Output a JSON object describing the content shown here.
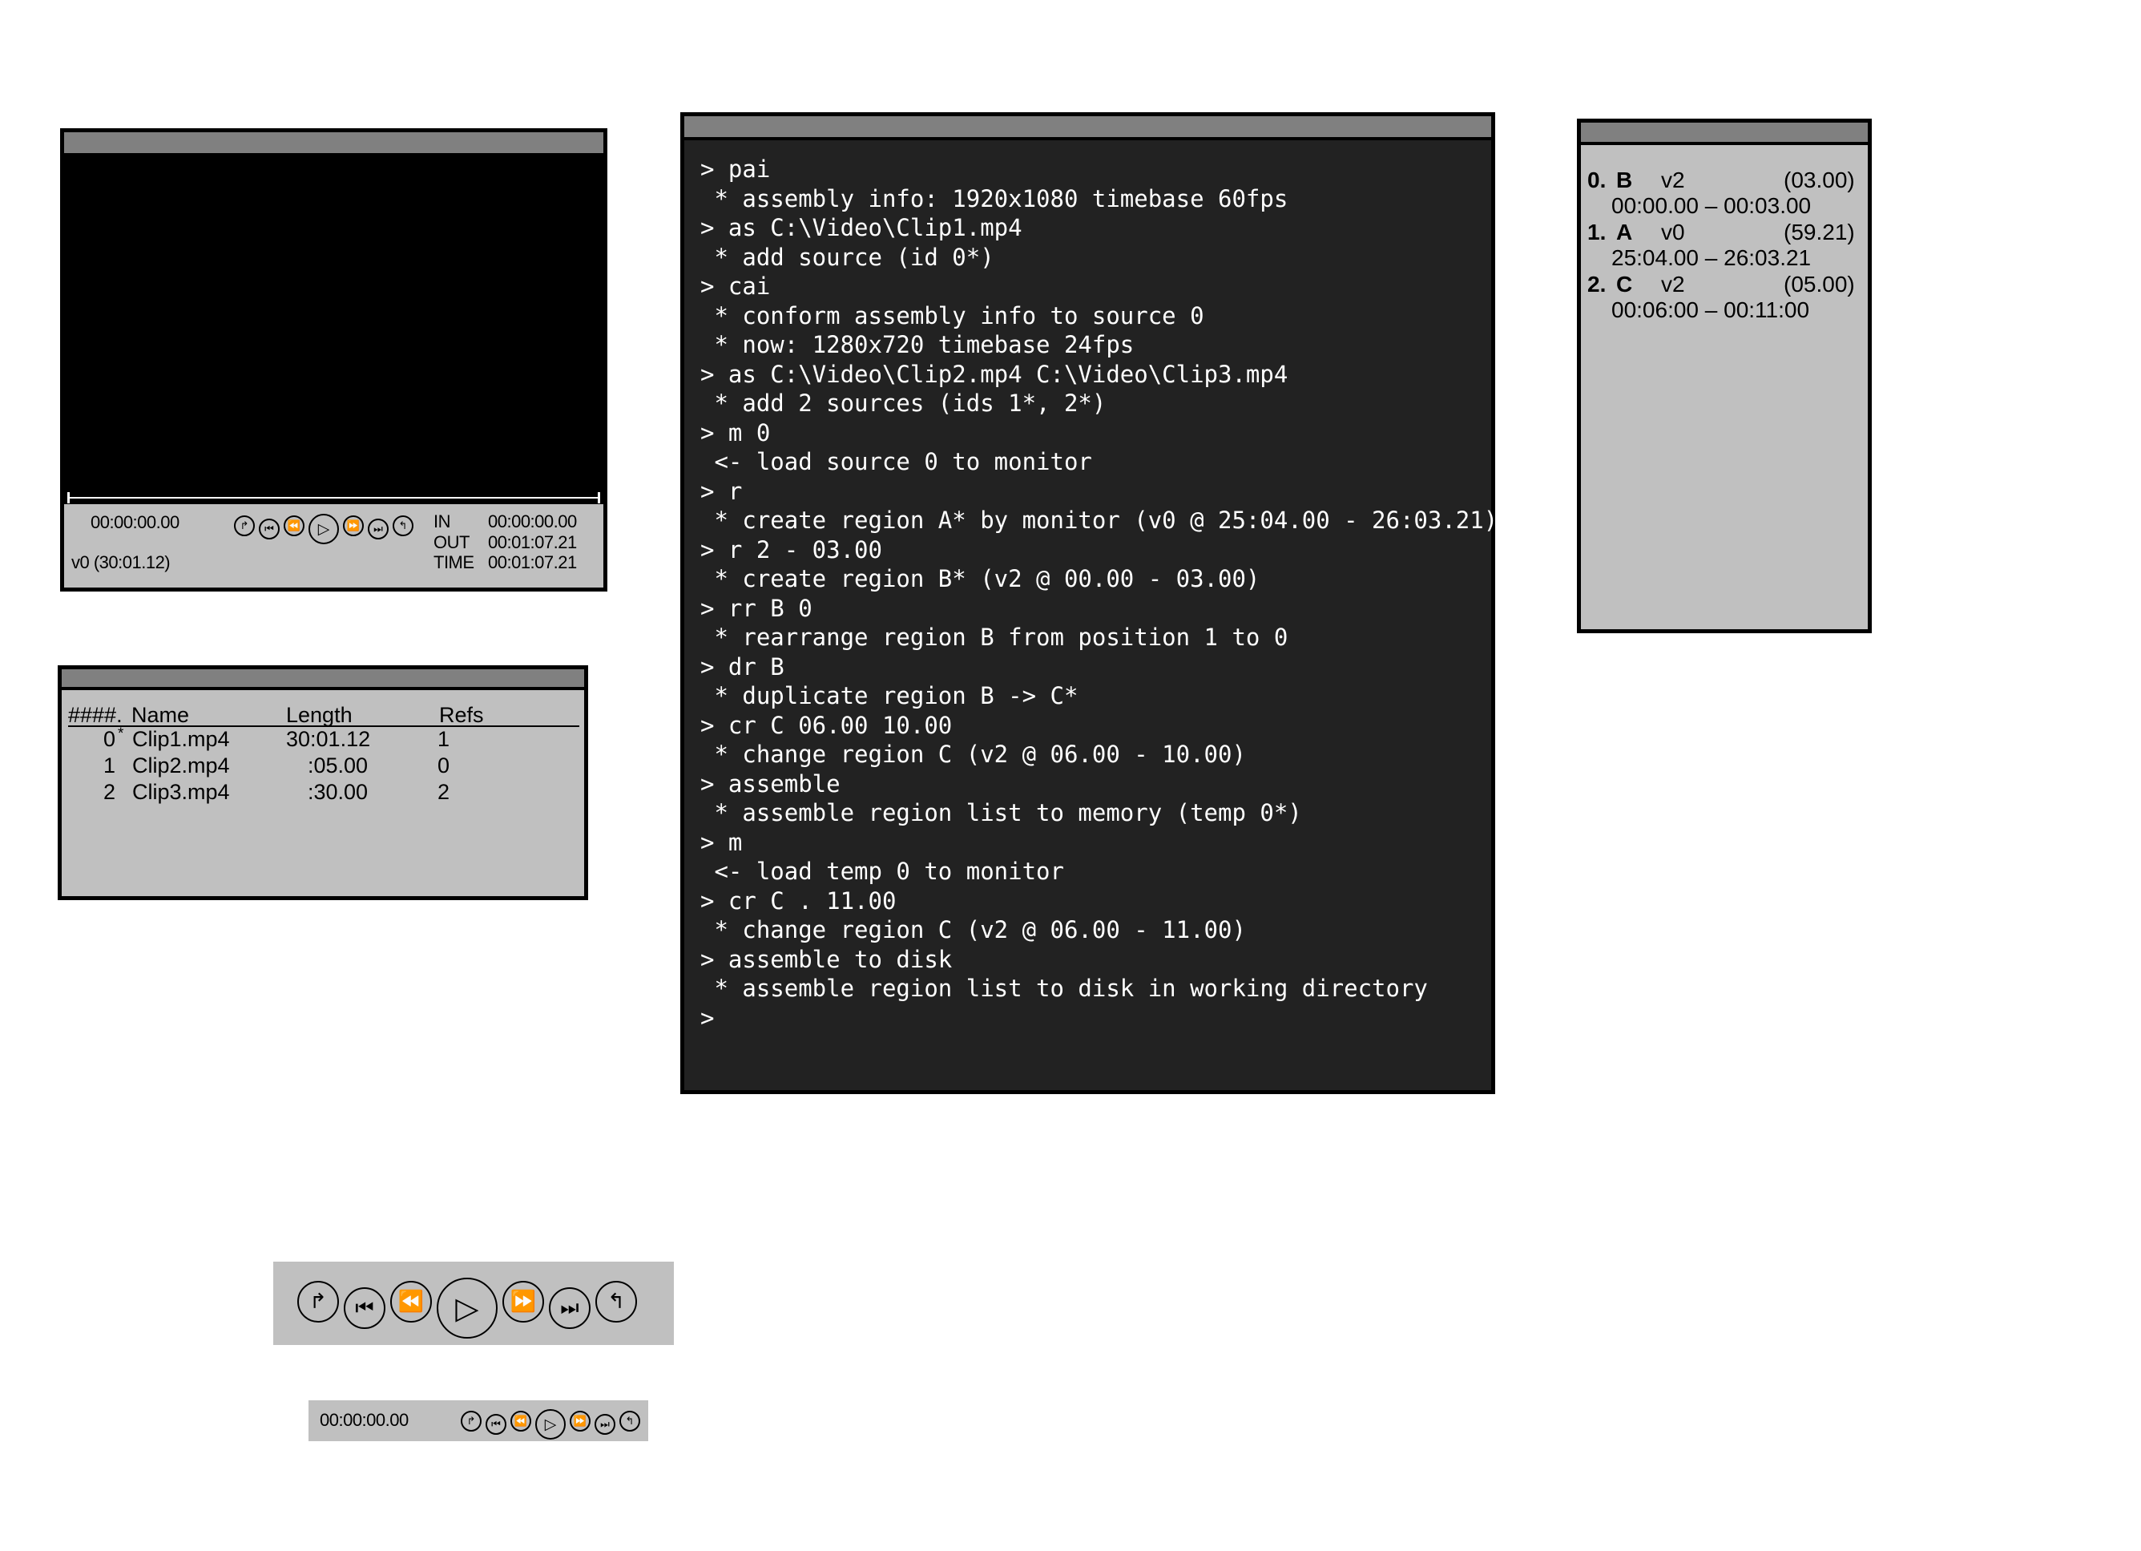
{
  "monitor": {
    "timecode": "00:00:00.00",
    "source_label": "v0 (30:01.12)",
    "in_label": "IN",
    "in_value": "00:00:00.00",
    "out_label": "OUT",
    "out_value": "00:01:07.21",
    "time_label": "TIME",
    "time_value": "00:01:07.21"
  },
  "transport_icons": [
    "mark-in-icon",
    "skip-back-icon",
    "rewind-icon",
    "play-icon",
    "fast-forward-icon",
    "skip-forward-icon",
    "mark-out-icon"
  ],
  "sources": {
    "headers": {
      "id": "####.",
      "name": "Name",
      "length": "Length",
      "refs": "Refs"
    },
    "rows": [
      {
        "id": "0",
        "marker": "*",
        "name": "Clip1.mp4",
        "length": "30:01.12",
        "refs": "1"
      },
      {
        "id": "1",
        "marker": "",
        "name": "Clip2.mp4",
        "length": ":05.00",
        "refs": "0"
      },
      {
        "id": "2",
        "marker": "",
        "name": "Clip3.mp4",
        "length": ":30.00",
        "refs": "2"
      }
    ]
  },
  "console": {
    "lines": [
      "> pai",
      " * assembly info: 1920x1080 timebase 60fps",
      "> as C:\\Video\\Clip1.mp4",
      " * add source (id 0*)",
      "> cai",
      " * conform assembly info to source 0",
      " * now: 1280x720 timebase 24fps",
      "> as C:\\Video\\Clip2.mp4 C:\\Video\\Clip3.mp4",
      " * add 2 sources (ids 1*, 2*)",
      "> m 0",
      " <- load source 0 to monitor",
      "> r",
      " * create region A* by monitor (v0 @ 25:04.00 - 26:03.21)",
      "> r 2 - 03.00",
      " * create region B* (v2 @ 00.00 - 03.00)",
      "> rr B 0",
      " * rearrange region B from position 1 to 0",
      "> dr B",
      " * duplicate region B -> C*",
      "> cr C 06.00 10.00",
      " * change region C (v2 @ 06.00 - 10.00)",
      "> assemble",
      " * assemble region list to memory (temp 0*)",
      "> m",
      " <- load temp 0 to monitor",
      "> cr C . 11.00",
      " * change region C (v2 @ 06.00 - 11.00)",
      "> assemble to disk",
      " * assemble region list to disk in working directory",
      ">"
    ]
  },
  "regions": {
    "items": [
      {
        "index": "0.",
        "name": "B",
        "source": "v2",
        "duration": "(03.00)",
        "range": "00:00.00 – 00:03.00"
      },
      {
        "index": "1.",
        "name": "A",
        "source": "v0",
        "duration": "(59.21)",
        "range": "25:04.00 – 26:03.21"
      },
      {
        "index": "2.",
        "name": "C",
        "source": "v2",
        "duration": "(05.00)",
        "range": "00:06:00 – 00:11:00"
      }
    ]
  },
  "transport_small": {
    "timecode": "00:00:00.00"
  }
}
